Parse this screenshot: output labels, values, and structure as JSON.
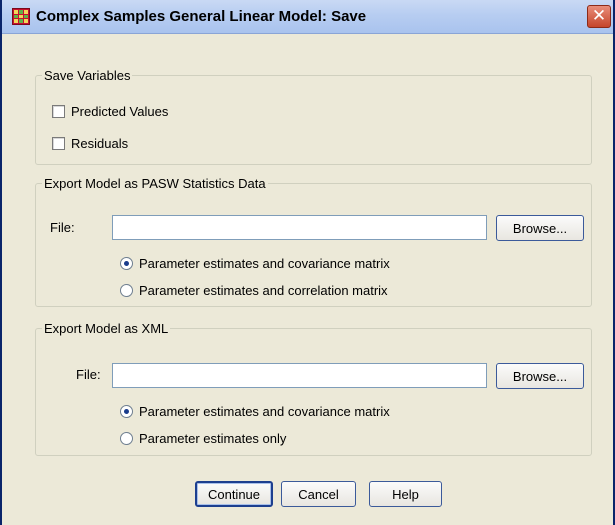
{
  "window": {
    "title": "Complex Samples General Linear Model: Save",
    "close_glyph": "✕"
  },
  "save_variables": {
    "legend": "Save Variables",
    "predicted_values": {
      "label": "Predicted Values",
      "checked": false
    },
    "residuals": {
      "label": "Residuals",
      "checked": false
    }
  },
  "export_pasw": {
    "legend": "Export Model as PASW Statistics Data",
    "file_label": "File:",
    "file_value": "",
    "browse_label": "Browse...",
    "options": [
      {
        "label": "Parameter estimates and covariance matrix",
        "selected": true
      },
      {
        "label": "Parameter estimates and correlation matrix",
        "selected": false
      }
    ]
  },
  "export_xml": {
    "legend": "Export Model as XML",
    "file_label": "File:",
    "file_value": "",
    "browse_label": "Browse...",
    "options": [
      {
        "label": "Parameter estimates and covariance matrix",
        "selected": true
      },
      {
        "label": "Parameter estimates only",
        "selected": false
      }
    ]
  },
  "buttons": {
    "continue": "Continue",
    "cancel": "Cancel",
    "help": "Help"
  }
}
